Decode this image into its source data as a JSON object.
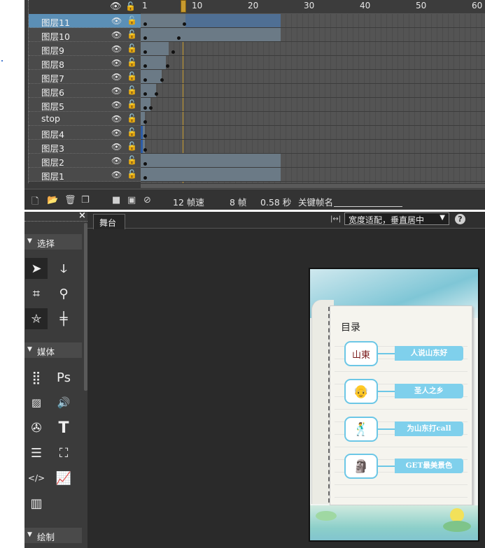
{
  "timeline": {
    "ruler_labels": [
      "1",
      "10",
      "20",
      "30",
      "40",
      "50",
      "60"
    ],
    "layers": [
      {
        "name": "图层11",
        "selected": true
      },
      {
        "name": "图层10",
        "selected": false
      },
      {
        "name": "图层9",
        "selected": false
      },
      {
        "name": "图层8",
        "selected": false
      },
      {
        "name": "图层7",
        "selected": false
      },
      {
        "name": "图层6",
        "selected": false
      },
      {
        "name": "图层5",
        "selected": false
      },
      {
        "name": "stop",
        "selected": false
      },
      {
        "name": "图层4",
        "selected": false
      },
      {
        "name": "图层3",
        "selected": false
      },
      {
        "name": "图层2",
        "selected": false
      },
      {
        "name": "图层1",
        "selected": false
      }
    ],
    "footer": {
      "fps": "12 帧速",
      "frame": "8 帧",
      "seconds": "0.58 秒",
      "keyframe_name_label": "关键帧名"
    }
  },
  "tools": {
    "close": "×",
    "sections": {
      "select": "选择",
      "media": "媒体",
      "draw": "绘制"
    },
    "icons": [
      "arrow-select-icon",
      "lasso-icon",
      "transform-icon",
      "zoom-icon",
      "star-shape-icon",
      "guides-icon",
      "grid-icon",
      "photoshop-icon",
      "image-icon",
      "sound-icon",
      "video-reel-icon",
      "text-icon",
      "paragraph-icon",
      "presentation-icon",
      "code-icon",
      "chart-icon",
      "film-strip-icon"
    ],
    "ps_label": "Ps",
    "text_label": "T"
  },
  "stage": {
    "tab": "舞台",
    "fit_mode": "宽度适配，垂直居中",
    "help": "?",
    "toc_title": "目录",
    "toc_items": [
      "人说山东好",
      "圣人之乡",
      "为山东打call",
      "GET最美景色"
    ]
  }
}
